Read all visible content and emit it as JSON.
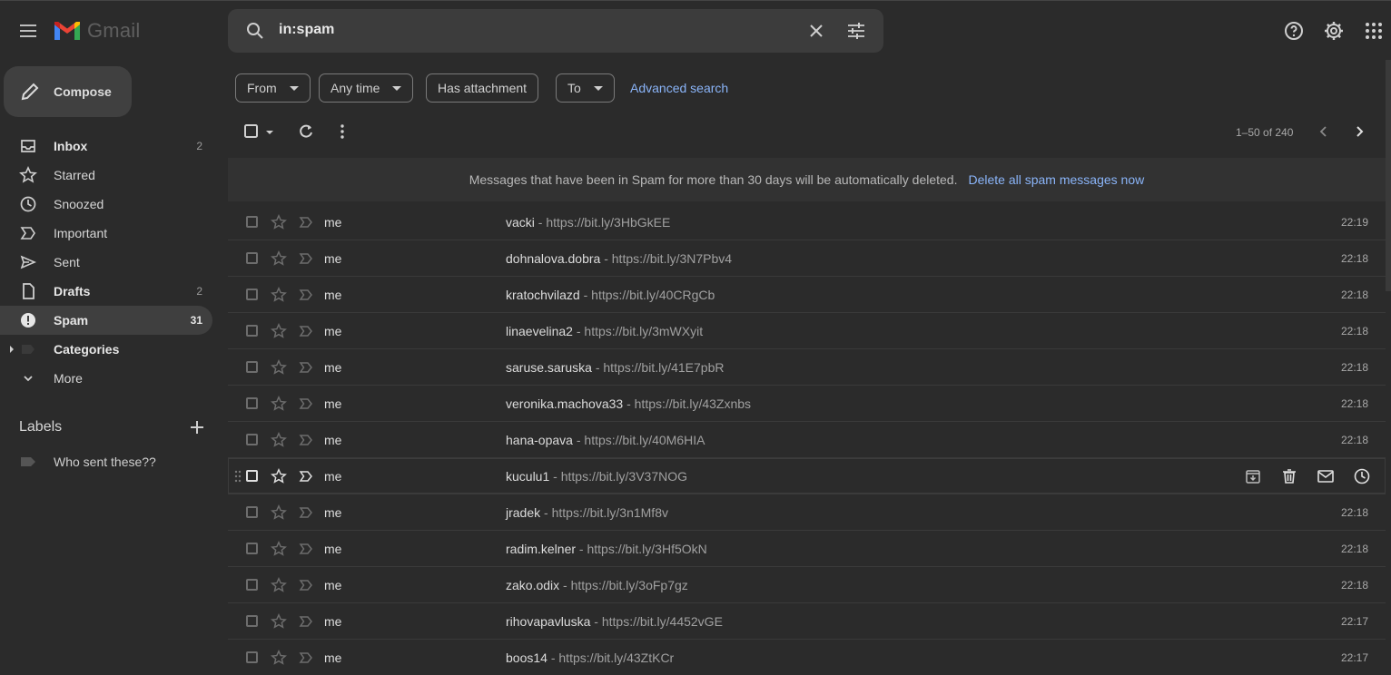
{
  "app": {
    "name": "Gmail"
  },
  "search": {
    "value": "in:spam"
  },
  "compose_label": "Compose",
  "nav": [
    {
      "label": "Inbox",
      "count": "2",
      "icon": "inbox-icon",
      "bold": true,
      "active": false
    },
    {
      "label": "Starred",
      "count": "",
      "icon": "star-icon",
      "bold": false,
      "active": false
    },
    {
      "label": "Snoozed",
      "count": "",
      "icon": "clock-icon",
      "bold": false,
      "active": false
    },
    {
      "label": "Important",
      "count": "",
      "icon": "important-icon",
      "bold": false,
      "active": false
    },
    {
      "label": "Sent",
      "count": "",
      "icon": "send-icon",
      "bold": false,
      "active": false
    },
    {
      "label": "Drafts",
      "count": "2",
      "icon": "draft-icon",
      "bold": true,
      "active": false
    },
    {
      "label": "Spam",
      "count": "31",
      "icon": "spam-icon",
      "bold": true,
      "active": true
    },
    {
      "label": "Categories",
      "count": "",
      "icon": "label-icon",
      "bold": true,
      "active": false
    },
    {
      "label": "More",
      "count": "",
      "icon": "chevron-down-icon",
      "bold": false,
      "active": false
    }
  ],
  "labels": {
    "heading": "Labels",
    "items": [
      {
        "label": "Who sent these??"
      }
    ]
  },
  "filters": {
    "from": "From",
    "any_time": "Any time",
    "has_attachment": "Has attachment",
    "to": "To",
    "advanced": "Advanced search"
  },
  "pagination": {
    "text": "1–50 of 240"
  },
  "banner": {
    "message": "Messages that have been in Spam for more than 30 days will be automatically deleted.",
    "action": "Delete all spam messages now"
  },
  "emails": [
    {
      "sender": "me",
      "subject": "vacki",
      "snippet": "https://bit.ly/3HbGkEE",
      "time": "22:19"
    },
    {
      "sender": "me",
      "subject": "dohnalova.dobra",
      "snippet": "https://bit.ly/3N7Pbv4",
      "time": "22:18"
    },
    {
      "sender": "me",
      "subject": "kratochvilazd",
      "snippet": "https://bit.ly/40CRgCb",
      "time": "22:18"
    },
    {
      "sender": "me",
      "subject": "linaevelina2",
      "snippet": "https://bit.ly/3mWXyit",
      "time": "22:18"
    },
    {
      "sender": "me",
      "subject": "saruse.saruska",
      "snippet": "https://bit.ly/41E7pbR",
      "time": "22:18"
    },
    {
      "sender": "me",
      "subject": "veronika.machova33",
      "snippet": "https://bit.ly/43Zxnbs",
      "time": "22:18"
    },
    {
      "sender": "me",
      "subject": "hana-opava",
      "snippet": "https://bit.ly/40M6HIA",
      "time": "22:18"
    },
    {
      "sender": "me",
      "subject": "kuculu1",
      "snippet": "https://bit.ly/3V37NOG",
      "time": "",
      "hover": true
    },
    {
      "sender": "me",
      "subject": "jradek",
      "snippet": "https://bit.ly/3n1Mf8v",
      "time": "22:18"
    },
    {
      "sender": "me",
      "subject": "radim.kelner",
      "snippet": "https://bit.ly/3Hf5OkN",
      "time": "22:18"
    },
    {
      "sender": "me",
      "subject": "zako.odix",
      "snippet": "https://bit.ly/3oFp7gz",
      "time": "22:18"
    },
    {
      "sender": "me",
      "subject": "rihovapavluska",
      "snippet": "https://bit.ly/4452vGE",
      "time": "22:17"
    },
    {
      "sender": "me",
      "subject": "boos14",
      "snippet": "https://bit.ly/43ZtKCr",
      "time": "22:17"
    }
  ],
  "colors": {
    "background": "#2b2b2b",
    "link": "#8ab4f8",
    "gmail_red": "#ea4335",
    "gmail_blue": "#4285f4",
    "gmail_yellow": "#fbbc04",
    "gmail_green": "#34a853"
  }
}
